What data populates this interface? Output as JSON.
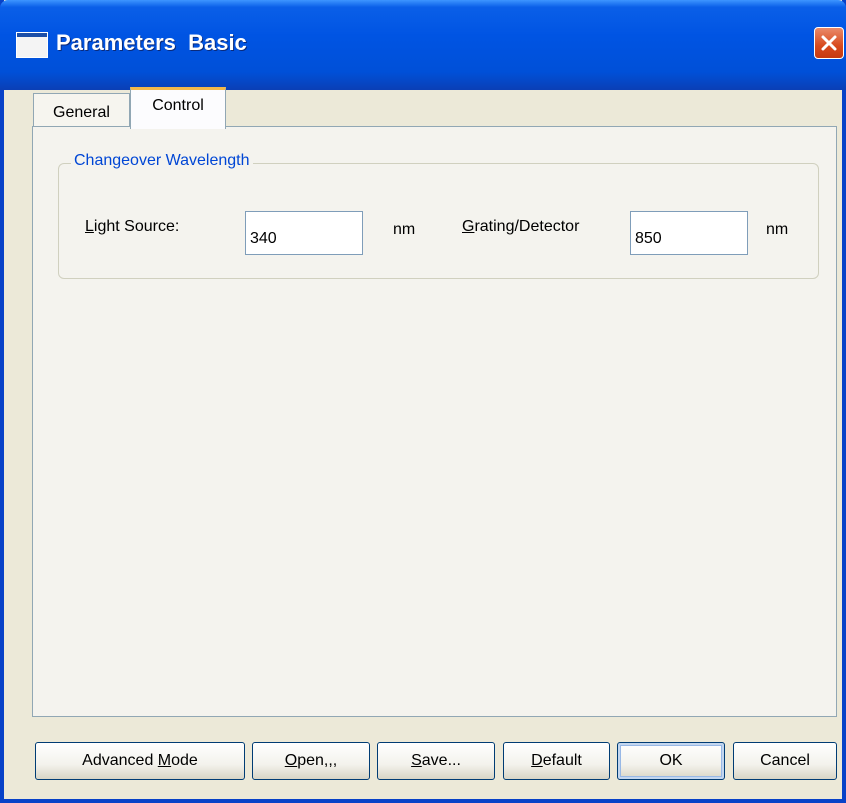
{
  "window": {
    "title": "Parameters  Basic"
  },
  "tabs": [
    {
      "label": "General",
      "selected": false
    },
    {
      "label": "Control",
      "selected": true
    }
  ],
  "group": {
    "title": "Changeover Wavelength",
    "light_source": {
      "label_accel": "L",
      "label_rest": "ight Source:",
      "value": "340",
      "unit": "nm"
    },
    "grating_detector": {
      "label_accel": "G",
      "label_rest": "rating/Detector",
      "value": "850",
      "unit": "nm"
    }
  },
  "buttons": {
    "advanced": {
      "pre": "Advanced ",
      "accel": "M",
      "post": "ode"
    },
    "open": {
      "pre": "",
      "accel": "O",
      "post": "pen,,,"
    },
    "save": {
      "pre": "",
      "accel": "S",
      "post": "ave..."
    },
    "default": {
      "pre": "",
      "accel": "D",
      "post": "efault"
    },
    "ok": {
      "label": "OK"
    },
    "cancel": {
      "label": "Cancel"
    }
  },
  "icons": {
    "window": "window-icon",
    "close": "close-icon"
  },
  "colors": {
    "titlebar": "#0054e3",
    "close_button": "#d84a1e",
    "group_title": "#0046d5",
    "dialog_background": "#ece9d8",
    "selected_tab_accent": "#f3b84a"
  }
}
